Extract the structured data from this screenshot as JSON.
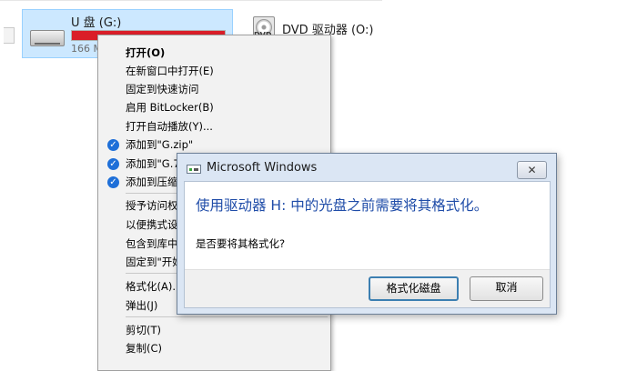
{
  "explorer": {
    "drive_u": {
      "name": "U 盘 (G:)",
      "free": "166 M",
      "bar_color": "#da1e28"
    },
    "drive_dvd": {
      "name": "DVD 驱动器 (O:)",
      "icon_text": "DVD"
    }
  },
  "context_menu": {
    "items": [
      "打开(O)",
      "在新窗口中打开(E)",
      "固定到快速访问",
      "启用 BitLocker(B)",
      "打开自动播放(Y)...",
      "添加到\"G.zip\"",
      "添加到\"G.7",
      "添加到压缩",
      "授予访问权",
      "以便携式设",
      "包含到库中",
      "固定到\"开始",
      "格式化(A)...",
      "弹出(J)",
      "剪切(T)",
      "复制(C)"
    ]
  },
  "dialog": {
    "title": "Microsoft Windows",
    "close": "✕",
    "heading": "使用驱动器 H: 中的光盘之前需要将其格式化。",
    "question": "是否要将其格式化?",
    "primary_button": "格式化磁盘",
    "cancel_button": "取消"
  },
  "colors": {
    "accent": "#1f4ca8",
    "selection": "#cce8ff",
    "zip_icon": "#1e6fd8"
  }
}
